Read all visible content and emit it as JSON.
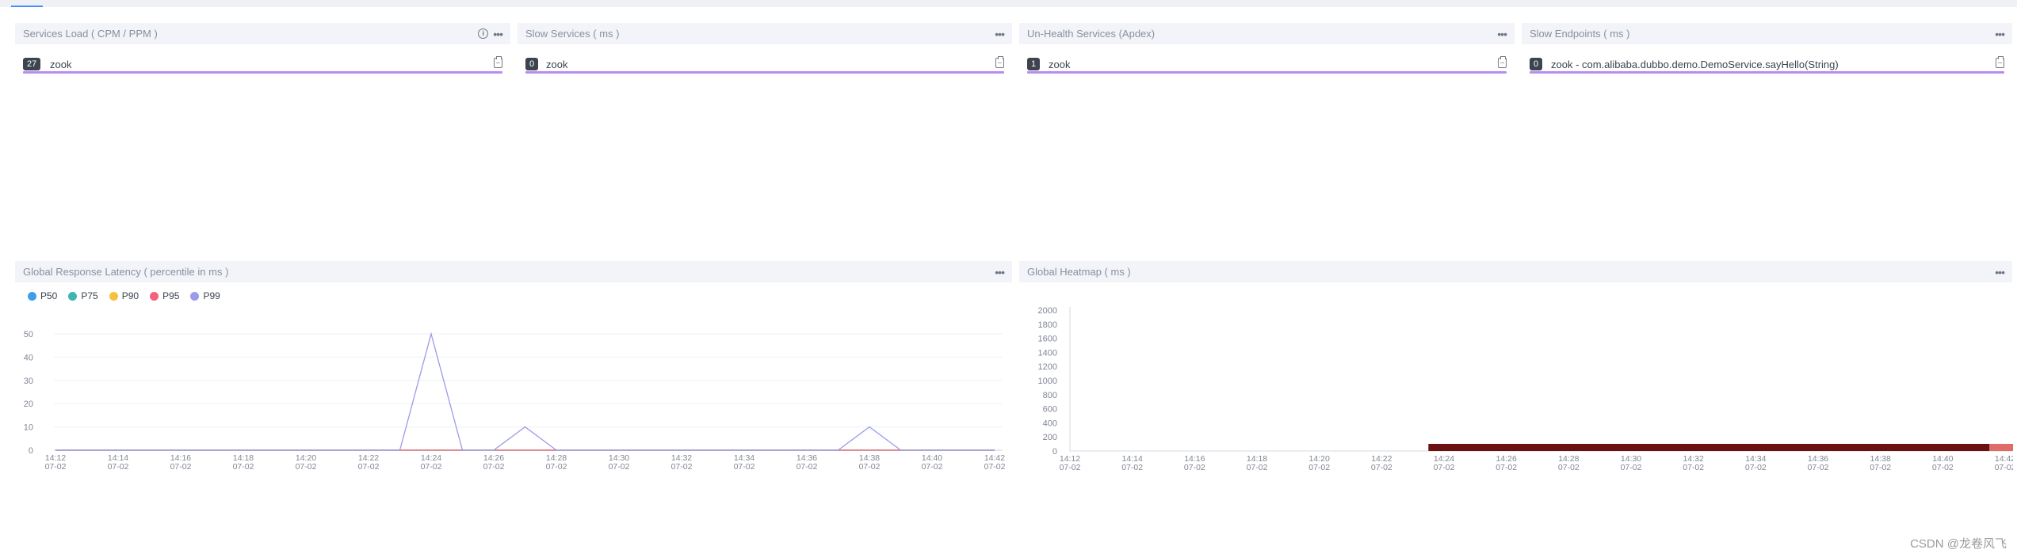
{
  "colors": {
    "header_bg": "#f3f4f9",
    "purple_bar": "#b98cf0",
    "badge_bg": "#3d444f",
    "p50": "#3f9ee8",
    "p75": "#3fb5b0",
    "p90": "#f6c142",
    "p95": "#f2637b",
    "p99": "#9b9bea",
    "heat_dark": "#6b1113",
    "heat_light": "#e06c69"
  },
  "panels": {
    "services_load": {
      "title": "Services Load ( CPM / PPM )",
      "count": "27",
      "label": "zook"
    },
    "slow_services": {
      "title": "Slow Services ( ms )",
      "count": "0",
      "label": "zook"
    },
    "unhealth_services": {
      "title": "Un-Health Services (Apdex)",
      "count": "1",
      "label": "zook"
    },
    "slow_endpoints": {
      "title": "Slow Endpoints ( ms )",
      "count": "0",
      "label": "zook - com.alibaba.dubbo.demo.DemoService.sayHello(String)"
    },
    "latency": {
      "title": "Global Response Latency ( percentile in ms )"
    },
    "heatmap": {
      "title": "Global Heatmap ( ms )"
    }
  },
  "icons": {
    "more": "more-dots-icon",
    "info": "info-circle-icon",
    "copy": "clipboard-icon"
  },
  "legend": [
    "P50",
    "P75",
    "P90",
    "P95",
    "P99"
  ],
  "chart_data": [
    {
      "type": "line",
      "title": "Global Response Latency ( percentile in ms )",
      "x": [
        "14:12",
        "14:13",
        "14:14",
        "14:15",
        "14:16",
        "14:17",
        "14:18",
        "14:19",
        "14:20",
        "14:21",
        "14:22",
        "14:23",
        "14:24",
        "14:25",
        "14:26",
        "14:27",
        "14:28",
        "14:29",
        "14:30",
        "14:31",
        "14:32",
        "14:33",
        "14:34",
        "14:35",
        "14:36",
        "14:37",
        "14:38",
        "14:39",
        "14:40",
        "14:41",
        "14:42"
      ],
      "x_tick_labels": [
        "14:12",
        "14:14",
        "14:16",
        "14:18",
        "14:20",
        "14:22",
        "14:24",
        "14:26",
        "14:28",
        "14:30",
        "14:32",
        "14:34",
        "14:36",
        "14:38",
        "14:40",
        "14:42"
      ],
      "x_date_label": "07-02",
      "ylim": [
        0,
        50
      ],
      "y_ticks": [
        0,
        10,
        20,
        30,
        40,
        50
      ],
      "series": [
        {
          "name": "P50",
          "values": [
            0,
            0,
            0,
            0,
            0,
            0,
            0,
            0,
            0,
            0,
            0,
            0,
            0,
            0,
            0,
            0,
            0,
            0,
            0,
            0,
            0,
            0,
            0,
            0,
            0,
            0,
            0,
            0,
            0,
            0,
            0
          ]
        },
        {
          "name": "P75",
          "values": [
            0,
            0,
            0,
            0,
            0,
            0,
            0,
            0,
            0,
            0,
            0,
            0,
            0,
            0,
            0,
            0,
            0,
            0,
            0,
            0,
            0,
            0,
            0,
            0,
            0,
            0,
            0,
            0,
            0,
            0,
            0
          ]
        },
        {
          "name": "P90",
          "values": [
            0,
            0,
            0,
            0,
            0,
            0,
            0,
            0,
            0,
            0,
            0,
            0,
            0,
            0,
            0,
            0,
            0,
            0,
            0,
            0,
            0,
            0,
            0,
            0,
            0,
            0,
            0,
            0,
            0,
            0,
            0
          ]
        },
        {
          "name": "P95",
          "values": [
            0,
            0,
            0,
            0,
            0,
            0,
            0,
            0,
            0,
            0,
            0,
            0,
            0,
            0,
            0,
            0,
            0,
            0,
            0,
            0,
            0,
            0,
            0,
            0,
            0,
            0,
            0,
            0,
            0,
            0,
            0
          ]
        },
        {
          "name": "P99",
          "values": [
            0,
            0,
            0,
            0,
            0,
            0,
            0,
            0,
            0,
            0,
            0,
            0,
            50,
            0,
            0,
            10,
            0,
            0,
            0,
            0,
            0,
            0,
            0,
            0,
            0,
            0,
            10,
            0,
            0,
            0,
            0
          ]
        }
      ],
      "legend_position": "top-left"
    },
    {
      "type": "heatmap",
      "title": "Global Heatmap ( ms )",
      "x": [
        "14:12",
        "14:13",
        "14:14",
        "14:15",
        "14:16",
        "14:17",
        "14:18",
        "14:19",
        "14:20",
        "14:21",
        "14:22",
        "14:23",
        "14:24",
        "14:25",
        "14:26",
        "14:27",
        "14:28",
        "14:29",
        "14:30",
        "14:31",
        "14:32",
        "14:33",
        "14:34",
        "14:35",
        "14:36",
        "14:37",
        "14:38",
        "14:39",
        "14:40",
        "14:41",
        "14:42"
      ],
      "x_tick_labels": [
        "14:12",
        "14:14",
        "14:16",
        "14:18",
        "14:20",
        "14:22",
        "14:24",
        "14:26",
        "14:28",
        "14:30",
        "14:32",
        "14:34",
        "14:36",
        "14:38",
        "14:40",
        "14:42"
      ],
      "x_date_label": "07-02",
      "y_ticks": [
        0,
        200,
        400,
        600,
        800,
        1000,
        1200,
        1400,
        1600,
        1800,
        2000
      ],
      "ylim": [
        0,
        2000
      ],
      "cells": [
        {
          "from": "14:24",
          "to": "14:42",
          "bucket": 0,
          "level": "high"
        },
        {
          "from": "14:42",
          "to": "14:43",
          "bucket": 0,
          "level": "medium"
        }
      ]
    }
  ],
  "watermark": "CSDN @龙卷风飞"
}
